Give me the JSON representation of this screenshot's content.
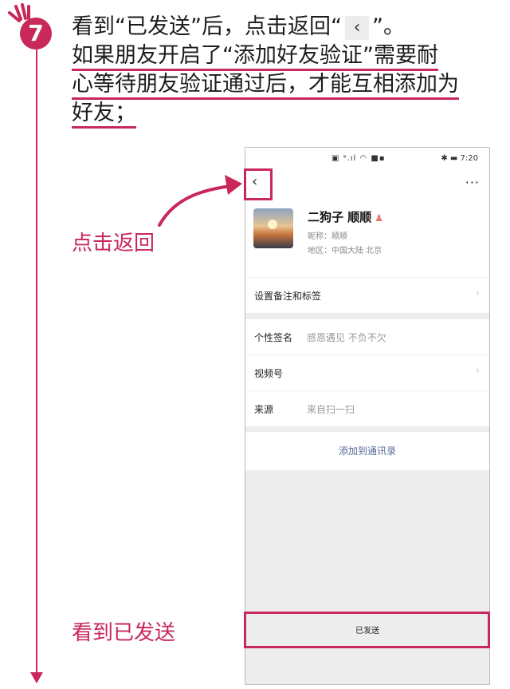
{
  "step": {
    "number": "7"
  },
  "instruction": {
    "line1_pre": "看到“已发送”后，点击返回“",
    "back_glyph": "‹",
    "line1_post": "”。",
    "note_lines": [
      "如果朋友开启了“添加好友验证”需要耐",
      "心等待朋友验证通过后，才能互相添加为",
      "好友；"
    ]
  },
  "annotations": {
    "back": "点击返回",
    "sent": "看到已发送"
  },
  "phone": {
    "status_left": "▣ ᵃ.ıl ◠ ■▪",
    "status_right": "✱ ▬ 7:20",
    "nav": {
      "back": "‹",
      "more": "···"
    },
    "profile": {
      "name": "二狗子 顺顺",
      "gender_icon": "♟",
      "nickname": "昵称：顺顺",
      "region": "地区：中国大陆  北京"
    },
    "rows": {
      "remark": "设置备注和标签",
      "signature_label": "个性签名",
      "signature_value": "感恩遇见 不负不欠",
      "channels": "视频号",
      "source_label": "来源",
      "source_value": "来自扫一扫"
    },
    "chevron": "›",
    "add_button": "添加到通讯录",
    "sent_label": "已发送"
  },
  "colors": {
    "accent": "#c8285a",
    "link": "#576b95"
  }
}
